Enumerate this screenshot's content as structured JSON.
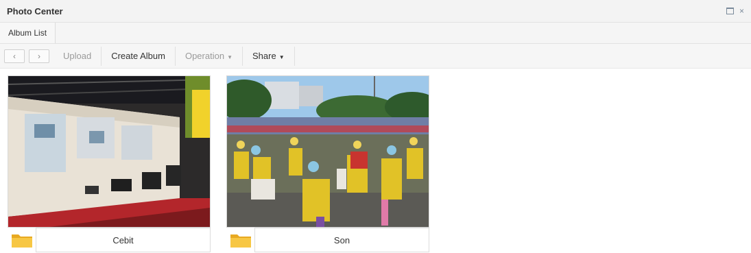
{
  "window": {
    "title": "Photo Center",
    "restore_icon": "restore-window-icon",
    "close_glyph": "×"
  },
  "tabs": [
    {
      "label": "Album List"
    }
  ],
  "toolbar": {
    "back_glyph": "‹",
    "forward_glyph": "›",
    "upload": "Upload",
    "create_album": "Create Album",
    "operation": "Operation",
    "share": "Share",
    "caret": "▼"
  },
  "albums": [
    {
      "name": "Cebit",
      "icon": "folder-icon"
    },
    {
      "name": "Son",
      "icon": "folder-icon"
    }
  ],
  "colors": {
    "folder": "#f5c13a",
    "title_bg": "#f3f3f3"
  }
}
